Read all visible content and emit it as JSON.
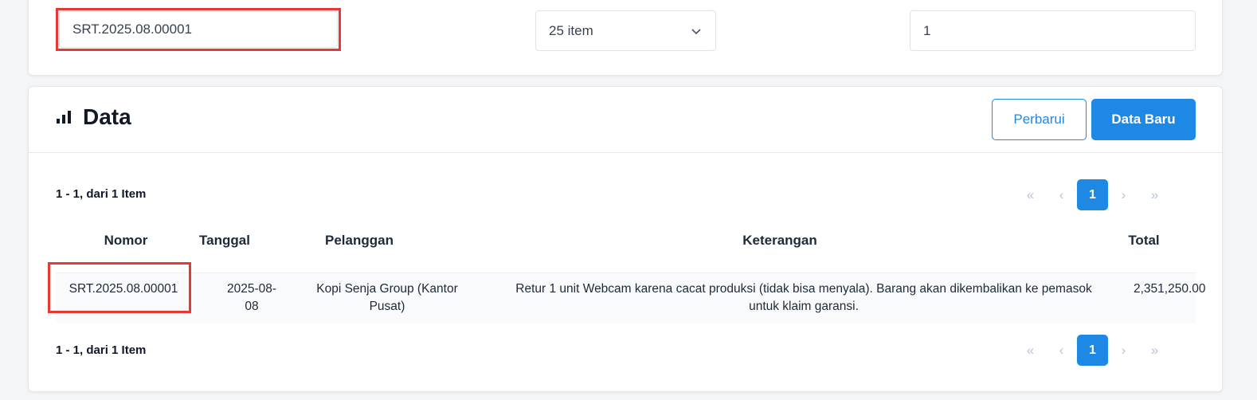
{
  "filters": {
    "search_value": "SRT.2025.08.00001",
    "page_size": "25 item",
    "page_number": "1"
  },
  "data_section": {
    "title": "Data",
    "refresh_label": "Perbarui",
    "new_label": "Data Baru",
    "range_text": "1 - 1, dari 1 Item",
    "pager": {
      "first": "«",
      "prev": "‹",
      "current": "1",
      "next": "›",
      "last": "»"
    },
    "columns": [
      "Nomor",
      "Tanggal",
      "Pelanggan",
      "Keterangan",
      "Total"
    ],
    "rows": [
      {
        "nomor": "SRT.2025.08.00001",
        "tanggal_line1": "2025-08-",
        "tanggal_line2": "08",
        "pelanggan_line1": "Kopi Senja Group (Kantor",
        "pelanggan_line2": "Pusat)",
        "keterangan_line1": "Retur 1 unit Webcam karena cacat produksi (tidak bisa menyala). Barang akan dikembalikan ke pemasok",
        "keterangan_line2": "untuk klaim garansi.",
        "total": "2,351,250.00"
      }
    ]
  },
  "colors": {
    "primary": "#1e88e5",
    "highlight": "#e53935"
  }
}
